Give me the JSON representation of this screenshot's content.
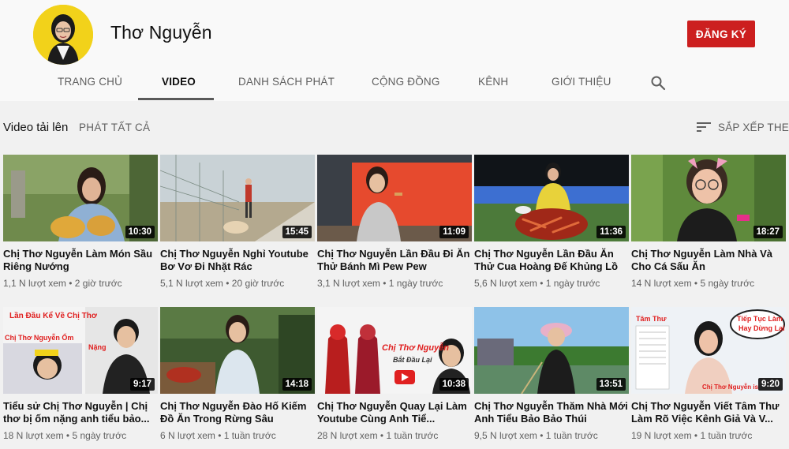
{
  "channel": {
    "name": "Thơ Nguyễn",
    "subscribe_label": "ĐĂNG KÝ"
  },
  "tabs": [
    {
      "label": "TRANG CHỦ"
    },
    {
      "label": "VIDEO"
    },
    {
      "label": "DANH SÁCH PHÁT"
    },
    {
      "label": "CỘNG ĐỒNG"
    },
    {
      "label": "KÊNH"
    },
    {
      "label": "GIỚI THIỆU"
    }
  ],
  "section": {
    "title": "Video tải lên",
    "play_all": "PHÁT TẤT CẢ",
    "sort_label": "SẮP XẾP THEO"
  },
  "icons": [
    "search-icon",
    "sort-icon"
  ],
  "colors": {
    "subscribe": "#cc1f1f",
    "background": "#f1f1f1",
    "header": "#f9f9f9"
  },
  "videos": [
    {
      "title": "Chị Thơ Nguyễn Làm Món Sầu Riêng Nướng",
      "duration": "10:30",
      "views": "1,1 N lượt xem",
      "age": "2 giờ trước"
    },
    {
      "title": "Chị Thơ Nguyễn Nghỉ Youtube Bơ Vơ Đi Nhặt Rác",
      "duration": "15:45",
      "views": "5,1 N lượt xem",
      "age": "20 giờ trước"
    },
    {
      "title": "Chị Thơ Nguyễn Lần Đầu Đi Ăn Thử Bánh Mì Pew Pew",
      "duration": "11:09",
      "views": "3,1 N lượt xem",
      "age": "1 ngày trước"
    },
    {
      "title": "Chị Thơ Nguyễn Lần Đầu Ăn Thử Cua Hoàng Đế Khủng Lồ",
      "duration": "11:36",
      "views": "5,6 N lượt xem",
      "age": "1 ngày trước"
    },
    {
      "title": "Chị Thơ Nguyễn Làm Nhà Và Cho Cá Sấu Ăn",
      "duration": "18:27",
      "views": "14 N lượt xem",
      "age": "5 ngày trước"
    },
    {
      "title": "Tiểu sử Chị Thơ Nguyễn | Chị thơ bị ốm nặng anh tiểu bảo...",
      "duration": "9:17",
      "views": "18 N lượt xem",
      "age": "5 ngày trước",
      "thumb_texts": [
        "Lần Đầu Kể Về Chị Thơ",
        "Chị Thơ Nguyễn Ốm",
        "Nặng"
      ]
    },
    {
      "title": "Chị Thơ Nguyễn Đào Hố Kiếm Đồ Ăn Trong Rừng Sâu",
      "duration": "14:18",
      "views": "6 N lượt xem",
      "age": "1 tuần trước"
    },
    {
      "title": "Chị Thơ Nguyễn Quay Lại Làm Youtube Cùng Anh Tiể...",
      "duration": "10:38",
      "views": "28 N lượt xem",
      "age": "1 tuần trước",
      "thumb_texts": [
        "Chị Thơ Nguyễn",
        "Bắt Đầu Lại"
      ]
    },
    {
      "title": "Chị Thơ Nguyễn Thăm Nhà Mới Anh Tiểu Bảo Bảo Thúi",
      "duration": "13:51",
      "views": "9,5 N lượt xem",
      "age": "1 tuần trước"
    },
    {
      "title": "Chị Thơ Nguyễn Viết Tâm Thư Làm Rõ Việc Kênh Giả Và V...",
      "duration": "9:20",
      "views": "19 N lượt xem",
      "age": "1 tuần trước",
      "thumb_texts": [
        "Tâm Thư",
        "Tiếp Tục Làm",
        "Hay Dừng Lại",
        "Chị Thơ Nguyễn is"
      ]
    }
  ]
}
